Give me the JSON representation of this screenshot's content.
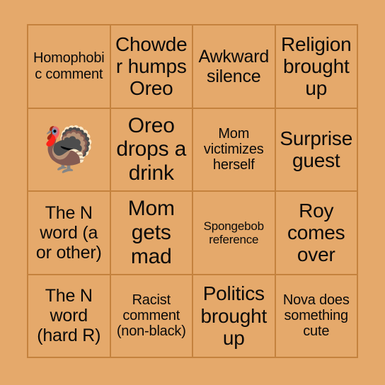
{
  "card": {
    "background_color": "#e5a96b",
    "border_color": "#c4823e",
    "text_color": "#0a0a0a",
    "columns": 4,
    "rows": 4,
    "cells": [
      {
        "text": "Homophobic comment",
        "size": "sm",
        "free": false
      },
      {
        "text": "Chowder humps Oreo",
        "size": "lg",
        "free": false
      },
      {
        "text": "Awkward silence",
        "size": "md",
        "free": false
      },
      {
        "text": "Religion brought up",
        "size": "lg",
        "free": false
      },
      {
        "text": "🦃",
        "size": "free",
        "free": true
      },
      {
        "text": "Oreo drops a drink",
        "size": "xl",
        "free": false
      },
      {
        "text": "Mom victimizes herself",
        "size": "sm",
        "free": false
      },
      {
        "text": "Surprise guest",
        "size": "lg",
        "free": false
      },
      {
        "text": "The N word (a or other)",
        "size": "md",
        "free": false
      },
      {
        "text": "Mom gets mad",
        "size": "xl",
        "free": false
      },
      {
        "text": "Spongebob reference",
        "size": "xs",
        "free": false
      },
      {
        "text": "Roy comes over",
        "size": "lg",
        "free": false
      },
      {
        "text": "The N word (hard R)",
        "size": "md",
        "free": false
      },
      {
        "text": "Racist comment (non-black)",
        "size": "sm",
        "free": false
      },
      {
        "text": "Politics brought up",
        "size": "lg",
        "free": false
      },
      {
        "text": "Nova does something cute",
        "size": "sm",
        "free": false
      }
    ]
  }
}
